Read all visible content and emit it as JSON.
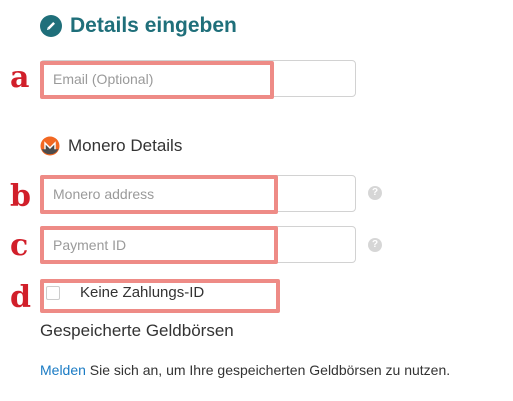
{
  "header": {
    "title": "Details eingeben",
    "icon": "pencil-icon",
    "color": "#1f6f7a"
  },
  "email": {
    "placeholder": "Email (Optional)",
    "value": ""
  },
  "monero_section": {
    "title": "Monero Details",
    "icon": "monero-logo-icon",
    "address": {
      "placeholder": "Monero address",
      "value": ""
    },
    "payment_id": {
      "placeholder": "Payment ID",
      "value": ""
    },
    "no_payment_id": {
      "label": "Keine Zahlungs-ID",
      "checked": false
    }
  },
  "wallets": {
    "heading": "Gespeicherte Geldbörsen",
    "login_link": "Melden",
    "login_rest": " Sie sich an, um Ihre gespeicherten Geldbörsen zu nutzen."
  },
  "annotations": {
    "a": "a",
    "b": "b",
    "c": "c",
    "d": "d",
    "color": "#d11f2a",
    "highlight_color": "#ee8b86"
  },
  "help_icon_glyph": "?"
}
